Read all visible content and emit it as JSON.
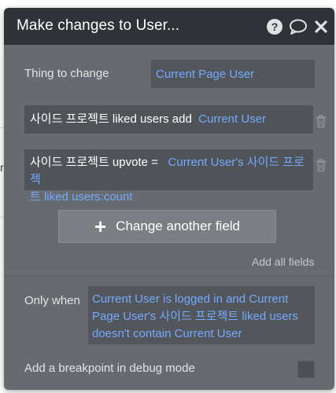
{
  "dialog": {
    "title": "Make changes to User..."
  },
  "thing_to_change": {
    "label": "Thing to change",
    "value": "Current Page User"
  },
  "fields": [
    {
      "field": "사이드 프로젝트 liked users add",
      "value": "Current User"
    },
    {
      "field": "사이드 프로젝트 upvote  =",
      "value_line1": "Current User's 사이드 프로젝",
      "value_line2": "트 liked users:count"
    }
  ],
  "change_another_field": {
    "icon": "plus-icon",
    "label": "Change another field"
  },
  "add_all_fields": "Add all fields",
  "only_when": {
    "label": "Only when",
    "line1": "Current User is logged in and Current",
    "line2": "Page User's 사이드 프로젝트 liked users",
    "line3": "doesn't contain Current User"
  },
  "breakpoint": {
    "label": "Add a breakpoint in debug mode",
    "checked": false
  },
  "colors": {
    "header": "#2f3236",
    "panel": "#676b6f",
    "dynamic_text": "#73a9ff"
  }
}
